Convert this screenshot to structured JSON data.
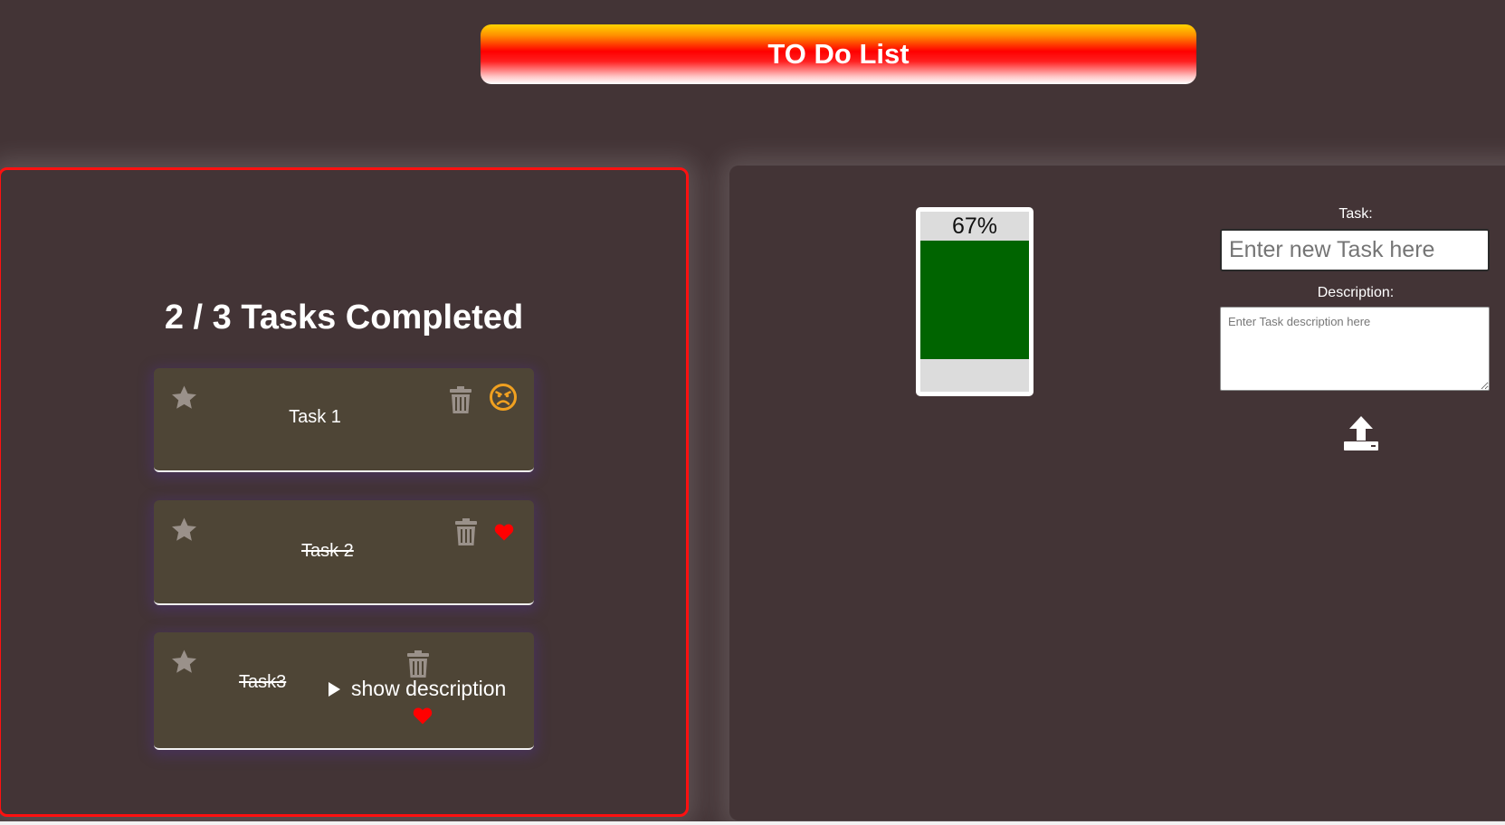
{
  "header": {
    "title": "TO Do List"
  },
  "summary": {
    "text": "2 / 3 Tasks Completed"
  },
  "tasks": [
    {
      "name": "Task 1",
      "completed": false,
      "starred": false,
      "status_icon": "angry-face-icon"
    },
    {
      "name": "Task 2",
      "completed": true,
      "starred": false,
      "status_icon": "heart-icon"
    },
    {
      "name": "Task3",
      "completed": true,
      "starred": false,
      "status_icon": "heart-icon",
      "show_description_label": "show description"
    }
  ],
  "progress": {
    "label": "67%",
    "fill_fraction": 0.67,
    "fill_color": "#006400"
  },
  "form": {
    "task_label": "Task:",
    "task_placeholder": "Enter new Task here",
    "task_value": "",
    "description_label": "Description:",
    "description_placeholder": "Enter Task description here",
    "description_value": "",
    "submit_icon": "upload-icon"
  },
  "colors": {
    "background": "#433436",
    "card": "#4e4536",
    "panel_border": "#ff1010",
    "icon_muted": "#9a918a",
    "heart": "#ff0000",
    "angry_face": "#f0a020"
  }
}
